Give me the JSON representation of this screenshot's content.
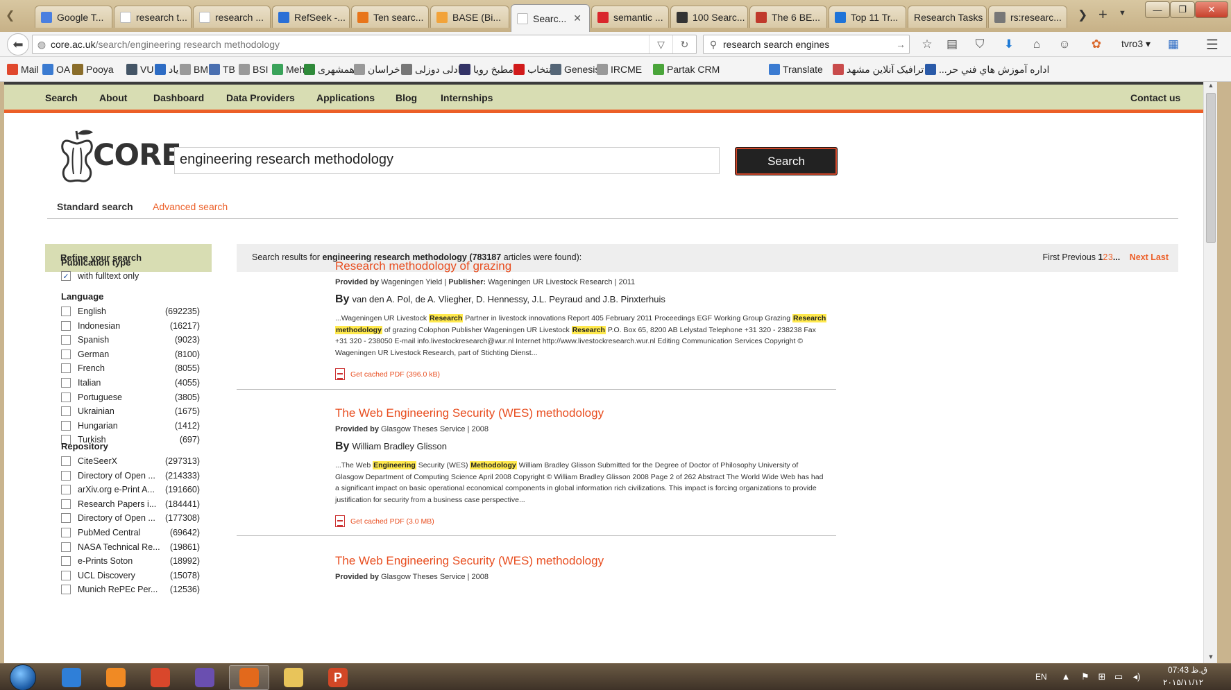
{
  "browser": {
    "tabs": [
      {
        "label": "Google T...",
        "color": "#4a7fe0"
      },
      {
        "label": "research t...",
        "color": "#ffffff"
      },
      {
        "label": "research ...",
        "color": "#ffffff"
      },
      {
        "label": "RefSeek -...",
        "color": "#2a6fd6"
      },
      {
        "label": "Ten searc...",
        "color": "#e8751a"
      },
      {
        "label": "BASE (Bi...",
        "color": "#f2a33a"
      },
      {
        "label": "Searc...",
        "color": "#ffffff",
        "active": true
      },
      {
        "label": "semantic ...",
        "color": "#d9262c"
      },
      {
        "label": "100 Searc...",
        "color": "#333333"
      },
      {
        "label": "The 6 BE...",
        "color": "#c0392b"
      },
      {
        "label": "Top 11 Tr...",
        "color": "#1e73d8"
      },
      {
        "label": "Research Tasks",
        "color": ""
      },
      {
        "label": "rs:researc...",
        "color": "#777777"
      }
    ],
    "url": {
      "host": "core.ac.uk",
      "path": "/search/engineering research methodology"
    },
    "search_box": "research search engines",
    "user": "tvro3",
    "bookmarks": [
      {
        "label": "Mail",
        "color": "#e0482d"
      },
      {
        "label": "OA",
        "color": "#3b7bd1"
      },
      {
        "label": "Pooya",
        "color": "#8a6d2a"
      },
      {
        "label": "VU",
        "color": "#445566"
      },
      {
        "label": "یاد",
        "color": "#2d6cc4"
      },
      {
        "label": "BMI",
        "color": "#999999"
      },
      {
        "label": "TB",
        "color": "#4a6fb0"
      },
      {
        "label": "BSI",
        "color": "#999999"
      },
      {
        "label": "Mehr",
        "color": "#3aa35a"
      },
      {
        "label": "همشهری",
        "color": "#2f8a3a"
      },
      {
        "label": "خراسان",
        "color": "#999999"
      },
      {
        "label": "دادلی دوزلی",
        "color": "#777777"
      },
      {
        "label": "مطبخ رویا",
        "color": "#333366"
      },
      {
        "label": "انتخاب",
        "color": "#d11a1a"
      },
      {
        "label": "Genesis",
        "color": "#556677"
      },
      {
        "label": "IRCME",
        "color": "#999999"
      },
      {
        "label": "Partak CRM",
        "color": "#4aa53a"
      },
      {
        "label": "Translate",
        "color": "#3b7bd1"
      },
      {
        "label": "ترافیک آنلاین مشهد",
        "color": "#c94b4b"
      },
      {
        "label": "...اداره آموزش هاي فني حر",
        "color": "#2a5aa8"
      }
    ]
  },
  "site": {
    "nav": [
      "Search",
      "About",
      "Dashboard",
      "Data Providers",
      "Applications",
      "Blog",
      "Internships"
    ],
    "contact": "Contact us",
    "logo_text": "CORE",
    "query": "engineering research methodology",
    "search_button": "Search",
    "standard_search": "Standard search",
    "advanced_search": "Advanced search",
    "accent_color": "#ec5f28",
    "header_color": "#d8ddb3"
  },
  "sidebar": {
    "title": "Refine your search",
    "publication_type": {
      "heading": "Publication type",
      "option": "with fulltext only",
      "checked": true
    },
    "language": {
      "heading": "Language",
      "items": [
        {
          "name": "English",
          "count": "(692235)"
        },
        {
          "name": "Indonesian",
          "count": "(16217)"
        },
        {
          "name": "Spanish",
          "count": "(9023)"
        },
        {
          "name": "German",
          "count": "(8100)"
        },
        {
          "name": "French",
          "count": "(8055)"
        },
        {
          "name": "Italian",
          "count": "(4055)"
        },
        {
          "name": "Portuguese",
          "count": "(3805)"
        },
        {
          "name": "Ukrainian",
          "count": "(1675)"
        },
        {
          "name": "Hungarian",
          "count": "(1412)"
        },
        {
          "name": "Turkish",
          "count": "(697)"
        }
      ]
    },
    "repository": {
      "heading": "Repository",
      "items": [
        {
          "name": "CiteSeerX",
          "count": "(297313)"
        },
        {
          "name": "Directory of Open ...",
          "count": "(214333)"
        },
        {
          "name": "arXiv.org e-Print A...",
          "count": "(191660)"
        },
        {
          "name": "Research Papers i...",
          "count": "(184441)"
        },
        {
          "name": "Directory of Open ...",
          "count": "(177308)"
        },
        {
          "name": "PubMed Central",
          "count": "(69642)"
        },
        {
          "name": "NASA Technical Re...",
          "count": "(19861)"
        },
        {
          "name": "e-Prints Soton",
          "count": "(18992)"
        },
        {
          "name": "UCL Discovery",
          "count": "(15078)"
        },
        {
          "name": "Munich RePEc Per...",
          "count": "(12536)"
        }
      ]
    }
  },
  "results": {
    "summary_prefix": "Search results for",
    "summary_query": "engineering research methodology",
    "summary_count": "(783187",
    "summary_suffix": "articles were found):",
    "pager": {
      "first": "First",
      "previous": "Previous",
      "current": "1",
      "p2": "2",
      "p3": "3",
      "ellipsis": "...",
      "next": "Next",
      "last": "Last"
    },
    "items": [
      {
        "title": "Research methodology of grazing",
        "provided_by_label": "Provided by",
        "provider": "Wageningen Yield",
        "publisher_label": "Publisher:",
        "publisher": "Wageningen UR Livestock Research | 2011",
        "by": "By",
        "authors": "van den A. Pol, de A. Vliegher, D. Hennessy, J.L. Peyraud and J.B. Pinxterhuis",
        "snippet": [
          {
            "t": "...Wageningen UR Livestock "
          },
          {
            "t": "Research",
            "h": true
          },
          {
            "t": " Partner in livestock innovations Report 405 February 2011 Proceedings EGF Working Group Grazing "
          },
          {
            "t": "Research",
            "h": true
          },
          {
            "t": " "
          },
          {
            "t": "methodology",
            "h": true
          },
          {
            "t": " of grazing Colophon Publisher Wageningen UR Livestock "
          },
          {
            "t": "Research",
            "h": true
          },
          {
            "t": " P.O. Box 65, 8200 AB Lelystad Telephone +31 320 - 238238 Fax +31 320 - 238050 E-mail info.livestockresearch@wur.nl Internet http://www.livestockresearch.wur.nl Editing Communication Services Copyright © Wageningen UR Livestock Research, part of Stichting Dienst..."
          }
        ],
        "pdf": "Get cached PDF (396.0 kB)"
      },
      {
        "title": "The Web Engineering Security (WES) methodology",
        "provided_by_label": "Provided by",
        "provider": "Glasgow Theses Service | 2008",
        "publisher_label": "",
        "publisher": "",
        "by": "By",
        "authors": "William Bradley Glisson",
        "snippet": [
          {
            "t": "...The Web "
          },
          {
            "t": "Engineering",
            "h": true
          },
          {
            "t": " Security (WES) "
          },
          {
            "t": "Methodology",
            "h": true
          },
          {
            "t": " William Bradley Glisson Submitted for the Degree of Doctor of Philosophy University of Glasgow Department of Computing Science April 2008 Copyright © William Bradley Glisson 2008 Page 2 of 262 Abstract The World Wide Web has had a significant impact on basic operational economical components in global information rich civilizations. This impact is forcing organizations to provide justification for security from a business case perspective..."
          }
        ],
        "pdf": "Get cached PDF (3.0 MB)"
      },
      {
        "title": "The Web Engineering Security (WES) methodology",
        "provided_by_label": "Provided by",
        "provider": "Glasgow Theses Service | 2008",
        "publisher_label": "",
        "publisher": "",
        "by": "",
        "authors": "",
        "snippet": [],
        "pdf": ""
      }
    ]
  },
  "taskbar": {
    "apps": [
      {
        "name": "internet-explorer",
        "color": "#2f7fd8"
      },
      {
        "name": "media-player",
        "color": "#f08a24"
      },
      {
        "name": "chrome",
        "color": "#d9472b"
      },
      {
        "name": "visual-studio",
        "color": "#6a4fb0"
      },
      {
        "name": "firefox",
        "color": "#e2691c",
        "active": true
      },
      {
        "name": "file-explorer",
        "color": "#e8c45a"
      },
      {
        "name": "powerpoint",
        "color": "#d24726",
        "label": "P"
      }
    ],
    "lang": "EN",
    "time": "07:43 ق.ظ",
    "date": "۲۰۱۵/۱۱/۱۲"
  }
}
